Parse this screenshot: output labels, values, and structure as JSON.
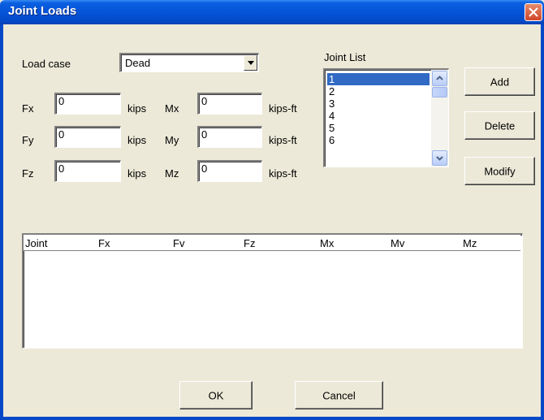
{
  "window": {
    "title": "Joint Loads"
  },
  "load_case": {
    "label": "Load case",
    "value": "Dead"
  },
  "forces": [
    {
      "label": "Fx",
      "value": "0",
      "unit": "kips"
    },
    {
      "label": "Fy",
      "value": "0",
      "unit": "kips"
    },
    {
      "label": "Fz",
      "value": "0",
      "unit": "kips"
    }
  ],
  "moments": [
    {
      "label": "Mx",
      "value": "0",
      "unit": "kips-ft"
    },
    {
      "label": "My",
      "value": "0",
      "unit": "kips-ft"
    },
    {
      "label": "Mz",
      "value": "0",
      "unit": "kips-ft"
    }
  ],
  "joint_list": {
    "label": "Joint List",
    "items": [
      "1",
      "2",
      "3",
      "4",
      "5",
      "6"
    ],
    "selected": "1"
  },
  "buttons": {
    "add": "Add",
    "delete": "Delete",
    "modify": "Modify",
    "ok": "OK",
    "cancel": "Cancel"
  },
  "table": {
    "columns": [
      "Joint",
      "Fx",
      "Fv",
      "Fz",
      "Mx",
      "Mv",
      "Mz"
    ],
    "rows": []
  }
}
